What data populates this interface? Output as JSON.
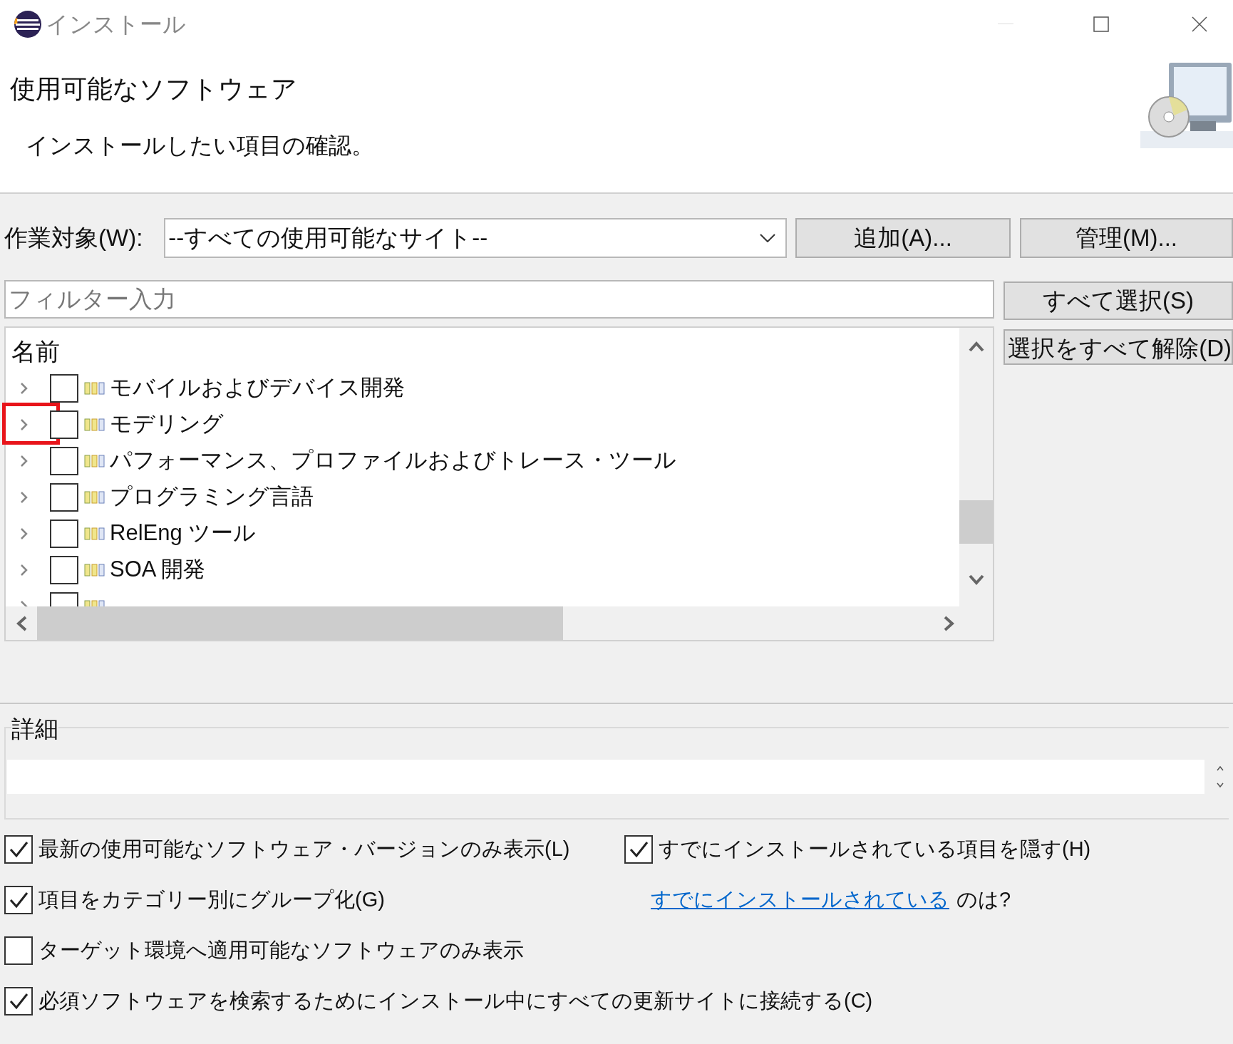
{
  "window": {
    "title": "インストール"
  },
  "header": {
    "title": "使用可能なソフトウェア",
    "description": "インストールしたい項目の確認。"
  },
  "work_with": {
    "label": "作業対象(W):",
    "value": "--すべての使用可能なサイト--"
  },
  "add_button": "追加(A)...",
  "manage_button": "管理(M)...",
  "filter": {
    "placeholder": "フィルター入力"
  },
  "select_all_button": "すべて選択(S)",
  "deselect_all_button": "選択をすべて解除(D)",
  "tree": {
    "column": "名前",
    "items": [
      {
        "label": "モバイルおよびデバイス開発",
        "checked": false,
        "expanded": false
      },
      {
        "label": "モデリング",
        "checked": false,
        "expanded": false
      },
      {
        "label": "パフォーマンス、プロファイルおよびトレース・ツール",
        "checked": false,
        "expanded": false
      },
      {
        "label": "プログラミング言語",
        "checked": false,
        "expanded": false
      },
      {
        "label": "RelEng ツール",
        "checked": false,
        "expanded": false
      },
      {
        "label": "SOA 開発",
        "checked": false,
        "expanded": false
      },
      {
        "checked": false,
        "expanded": false
      }
    ]
  },
  "details": {
    "label": "詳細"
  },
  "options": [
    {
      "kind": "checkbox",
      "label": "最新の使用可能なソフトウェア・バージョンのみ表示(L)",
      "checked": true
    },
    {
      "kind": "checkbox",
      "label": "すでにインストールされている項目を隠す(H)",
      "checked": true
    },
    {
      "kind": "checkbox",
      "label": "項目をカテゴリー別にグループ化(G)",
      "checked": true
    },
    {
      "kind": "link",
      "link": "すでにインストールされている",
      "text": "のは?"
    },
    {
      "kind": "checkbox",
      "label": "ターゲット環境へ適用可能なソフトウェアのみ表示",
      "checked": false
    },
    {
      "kind": "checkbox",
      "label": "必須ソフトウェアを検索するためにインストール中にすべての更新サイトに接続する(C)",
      "checked": true
    }
  ]
}
